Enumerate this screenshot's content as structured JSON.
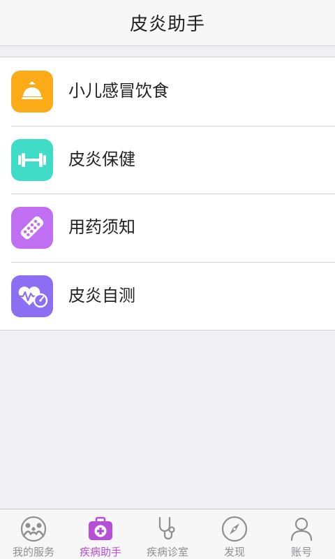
{
  "header": {
    "title": "皮炎助手"
  },
  "menu": {
    "items": [
      {
        "label": "小儿感冒饮食",
        "icon": "service-bell-icon",
        "color": "#fbab18"
      },
      {
        "label": "皮炎保健",
        "icon": "dumbbell-icon",
        "color": "#3fdcc8"
      },
      {
        "label": "用药须知",
        "icon": "pill-blister-icon",
        "color": "#c06ef2"
      },
      {
        "label": "皮炎自测",
        "icon": "heart-pulse-gauge-icon",
        "color": "#8b6ef2"
      }
    ]
  },
  "tabbar": {
    "active_color": "#b64ed6",
    "inactive_color": "#8e8e93",
    "tabs": [
      {
        "label": "我的服务",
        "icon": "family-icon",
        "active": false
      },
      {
        "label": "疾病助手",
        "icon": "medical-kit-icon",
        "active": true
      },
      {
        "label": "疾病诊室",
        "icon": "stethoscope-icon",
        "active": false
      },
      {
        "label": "发现",
        "icon": "compass-icon",
        "active": false
      },
      {
        "label": "账号",
        "icon": "user-icon",
        "active": false
      }
    ]
  }
}
